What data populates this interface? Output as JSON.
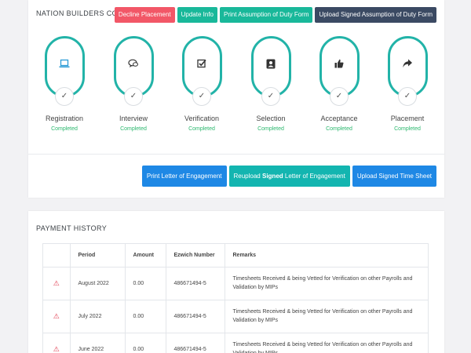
{
  "header": {
    "title": "NATION BUILDERS CORPS",
    "actions": [
      {
        "label": "Decline Placement",
        "color": "#f25767"
      },
      {
        "label": "Update Info",
        "color": "#19b89a"
      },
      {
        "label": "Print Assumption of Duty Form",
        "color": "#19b89a"
      },
      {
        "label": "Upload Signed Assumption of Duty Form",
        "color": "#3b4a63"
      }
    ]
  },
  "steps": [
    {
      "label": "Registration",
      "status": "Completed",
      "icon": "laptop-icon"
    },
    {
      "label": "Interview",
      "status": "Completed",
      "icon": "chat-icon"
    },
    {
      "label": "Verification",
      "status": "Completed",
      "icon": "checkbox-icon"
    },
    {
      "label": "Selection",
      "status": "Completed",
      "icon": "person-badge-icon"
    },
    {
      "label": "Acceptance",
      "status": "Completed",
      "icon": "thumbs-up-icon"
    },
    {
      "label": "Placement",
      "status": "Completed",
      "icon": "share-arrow-icon"
    }
  ],
  "bottom_actions": {
    "print_letter": "Print Letter of Engagement",
    "reupload_prefix": "Reupload ",
    "reupload_bold": "Signed",
    "reupload_suffix": " Letter of Engagement",
    "upload_timesheet": "Upload Signed Time Sheet"
  },
  "payment_history": {
    "title": "PAYMENT HISTORY",
    "columns": [
      "",
      "Period",
      "Amount",
      "Ezwich Number",
      "Remarks"
    ],
    "rows": [
      {
        "period": "August 2022",
        "amount": "0.00",
        "ezwich": "486671494-5",
        "remarks": "Timesheets Received & being Vetted for Verification on other Payrolls and Validation by MIPs"
      },
      {
        "period": "July 2022",
        "amount": "0.00",
        "ezwich": "486671494-5",
        "remarks": "Timesheets Received & being Vetted for Verification on other Payrolls and Validation by MIPs"
      },
      {
        "period": "June 2022",
        "amount": "0.00",
        "ezwich": "486671494-5",
        "remarks": "Timesheets Received & being Vetted for Verification on other Payrolls and Validation by MIPs"
      }
    ]
  },
  "colors": {
    "accent_teal": "#22b3a8",
    "completed_green": "#2db86f",
    "warning_red": "#e0364a"
  }
}
